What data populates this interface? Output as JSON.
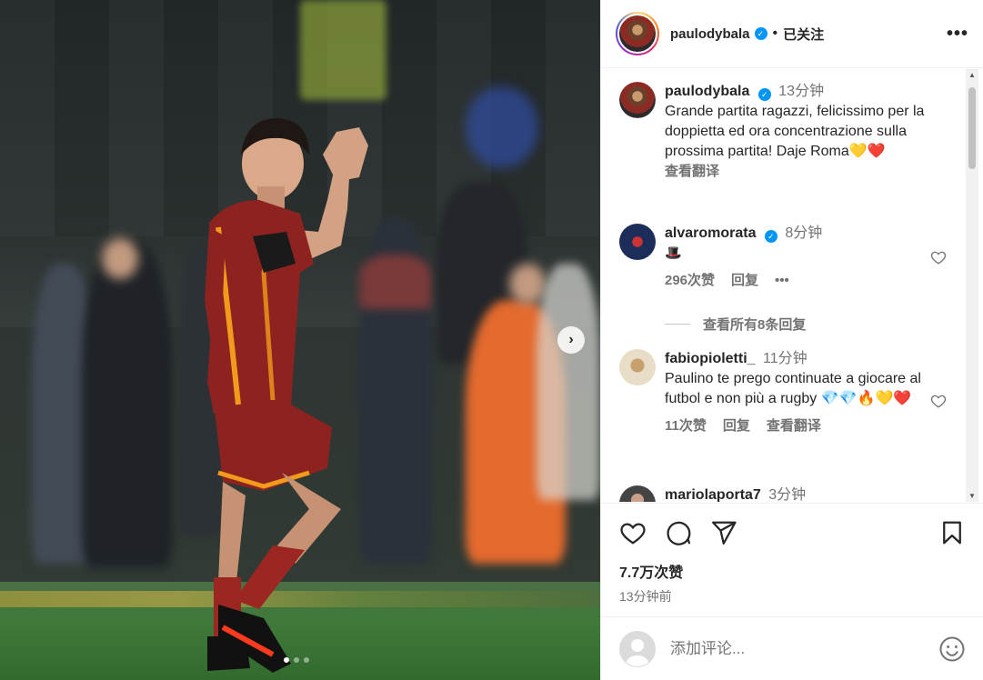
{
  "post": {
    "username": "paulodybala",
    "follow_state": "已关注",
    "more_icon": "more-horizontal-icon",
    "caption_time": "13分钟",
    "caption": "Grande partita ragazzi, felicissimo per la doppietta ed ora concentrazione sulla prossima partita! Daje Roma💛❤️",
    "see_translation": "查看翻译"
  },
  "comments": [
    {
      "username": "alvaromorata",
      "time": "8分钟",
      "text": "🎩",
      "likes": "296次赞",
      "reply": "回复",
      "view_replies": "查看所有8条回复"
    },
    {
      "username": "fabiopioletti_",
      "time": "11分钟",
      "text": "Paulino te prego continuate a giocare al futbol e non più a rugby 💎💎🔥💛❤️",
      "likes": "11次赞",
      "reply": "回复",
      "see_translation": "查看翻译"
    },
    {
      "username": "mariolaporta7",
      "time": "3分钟"
    }
  ],
  "actions": {
    "likes": "7.7万次赞",
    "posted": "13分钟前"
  },
  "add_comment": {
    "placeholder": "添加评论..."
  },
  "colors": {
    "verified": "#0095f6",
    "secondary_text": "#737373",
    "jersey": "#8c2320",
    "jersey_trim": "#f29a1c"
  }
}
